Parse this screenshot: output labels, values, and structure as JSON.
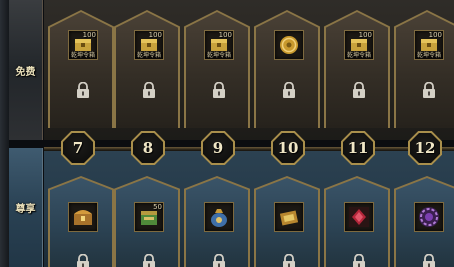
{
  "tracks": {
    "free_label": "免费",
    "premium_label": "尊享"
  },
  "levels": [
    "7",
    "8",
    "9",
    "10",
    "11",
    "12"
  ],
  "free_rewards": [
    {
      "icon": "gold-chest-icon",
      "count": "100",
      "tag": "乾坤令箱",
      "locked": true
    },
    {
      "icon": "gold-chest-icon",
      "count": "100",
      "tag": "乾坤令箱",
      "locked": true
    },
    {
      "icon": "gold-chest-icon",
      "count": "100",
      "tag": "乾坤令箱",
      "locked": true
    },
    {
      "icon": "gold-coin-icon",
      "count": "",
      "tag": "",
      "locked": true
    },
    {
      "icon": "gold-chest-icon",
      "count": "100",
      "tag": "乾坤令箱",
      "locked": true
    },
    {
      "icon": "gold-chest-icon",
      "count": "100",
      "tag": "乾坤令箱",
      "locked": true
    }
  ],
  "premium_rewards": [
    {
      "icon": "treasure-chest-icon",
      "count": "",
      "locked": true
    },
    {
      "icon": "green-box-icon",
      "count": "50",
      "locked": true
    },
    {
      "icon": "money-bag-icon",
      "count": "",
      "locked": true
    },
    {
      "icon": "scroll-box-icon",
      "count": "",
      "locked": true
    },
    {
      "icon": "red-gem-icon",
      "count": "",
      "locked": true
    },
    {
      "icon": "purple-orb-icon",
      "count": "",
      "locked": true
    }
  ],
  "colors": {
    "gold_frame": "#8a7546",
    "free_bg": "#342e26",
    "premium_bg": "#2c4354",
    "level_text": "#f1e7c6"
  }
}
